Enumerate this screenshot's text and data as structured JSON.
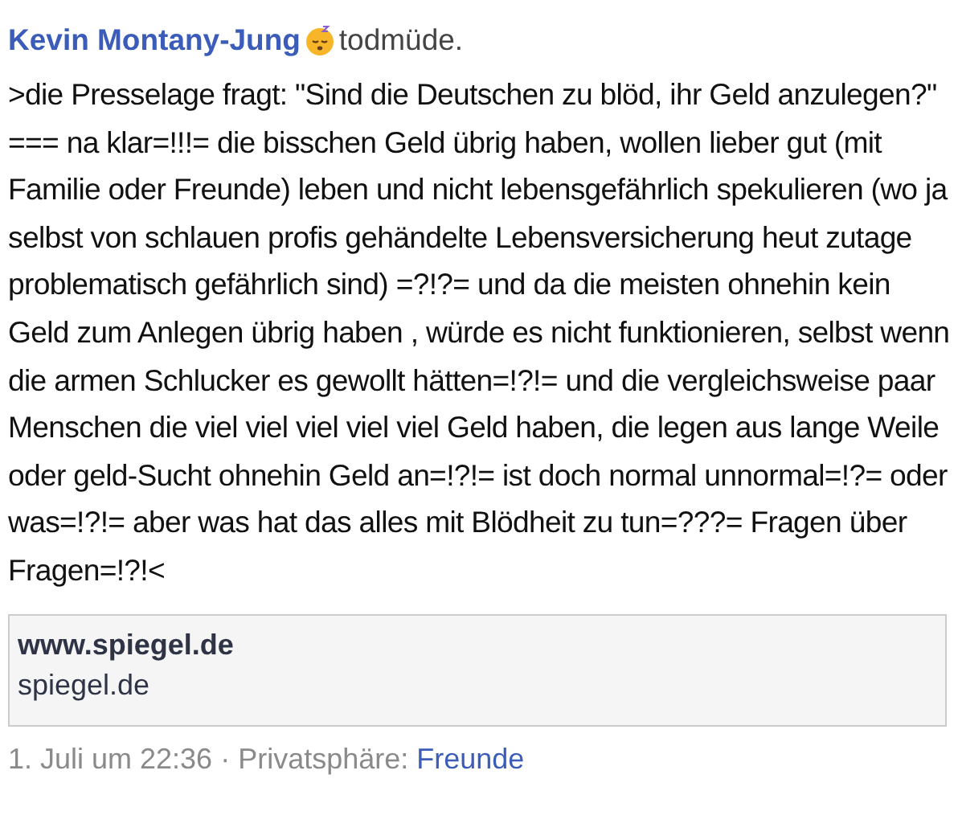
{
  "post": {
    "author": "Kevin Montany-Jung",
    "status": "todmüde.",
    "text": ">die Presselage fragt: \"Sind die Deutschen zu blöd, ihr Geld anzulegen?\" === na klar=!!!= die bisschen Geld übrig haben, wollen lieber gut (mit Familie oder  Freunde) leben und nicht lebensgefährlich spekulieren (wo ja selbst von schlauen profis gehändelte Lebensversicherung heut zutage problematisch gefährlich sind) =?!?= und da die meisten ohnehin kein Geld zum Anlegen übrig haben , würde es nicht funktionieren, selbst wenn die armen Schlucker es gewollt hätten=!?!= und die vergleichsweise paar Menschen die viel viel viel viel viel Geld haben, die legen aus lange Weile oder geld-Sucht ohnehin Geld an=!?!= ist doch normal unnormal=!?= oder was=!?!= aber was hat das alles mit Blödheit zu tun=???= Fragen über Fragen=!?!<",
    "link": {
      "title": "www.spiegel.de",
      "domain": "spiegel.de"
    },
    "time": "1. Juli um 22:36",
    "privacy_label": "· Privatsphäre:",
    "privacy": "Freunde"
  }
}
